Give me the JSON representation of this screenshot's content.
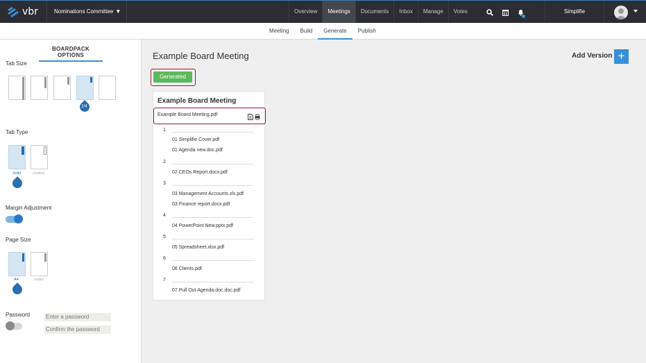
{
  "app": {
    "logo_text": "vbr",
    "committee": "Nominations Committee"
  },
  "nav": {
    "items": [
      "Overview",
      "Meetings",
      "Documents",
      "Inbox",
      "Manage",
      "Votes"
    ],
    "active": "Meetings"
  },
  "user": {
    "name": "Simplifie"
  },
  "subnav": {
    "items": [
      "Meeting",
      "Build",
      "Generate",
      "Publish"
    ],
    "active": "Generate"
  },
  "sidebar": {
    "title": "BOARDPACK OPTIONS",
    "tab_size_label": "Tab Size",
    "tab_size_selected": "1/4",
    "tab_type_label": "Tab Type",
    "tab_type_options": [
      "Solid",
      "Outline"
    ],
    "margin_label": "Margin Adjustment",
    "margin_enabled": true,
    "page_size_label": "Page Size",
    "page_size_options": [
      "A4",
      "Letter"
    ],
    "password_label": "Password",
    "password_enabled": false,
    "password_placeholder": "Enter a password",
    "confirm_placeholder": "Confirm the password"
  },
  "main": {
    "title": "Example Board Meeting",
    "add_version_label": "Add Version",
    "add_icon": "+",
    "generated_label": "Generated"
  },
  "card": {
    "title": "Example Board Meeting",
    "file_name": "Example Board Meeting.pdf",
    "sections": [
      {
        "num": "1",
        "docs": [
          "01 Simplifie Cover.pdf",
          "01 Agenda new.doc.pdf"
        ]
      },
      {
        "num": "2",
        "docs": [
          "02 CEOs Report.docx.pdf"
        ]
      },
      {
        "num": "3",
        "docs": [
          "03 Management Accounts.xls.pdf",
          "03 Finance report.docx.pdf"
        ]
      },
      {
        "num": "4",
        "docs": [
          "04 PowerPoint New.pptx.pdf"
        ]
      },
      {
        "num": "5",
        "docs": [
          "05 Spreadsheet.xlsx.pdf"
        ]
      },
      {
        "num": "6",
        "docs": [
          "06 Clients.pdf"
        ]
      },
      {
        "num": "7",
        "docs": [
          "07 Pull Out Agenda.doc.doc.pdf"
        ]
      }
    ]
  },
  "colors": {
    "accent": "#3a8fd8",
    "topbar": "#2c2d33",
    "generated": "#5cb85c",
    "highlight": "#9b1c2a"
  }
}
